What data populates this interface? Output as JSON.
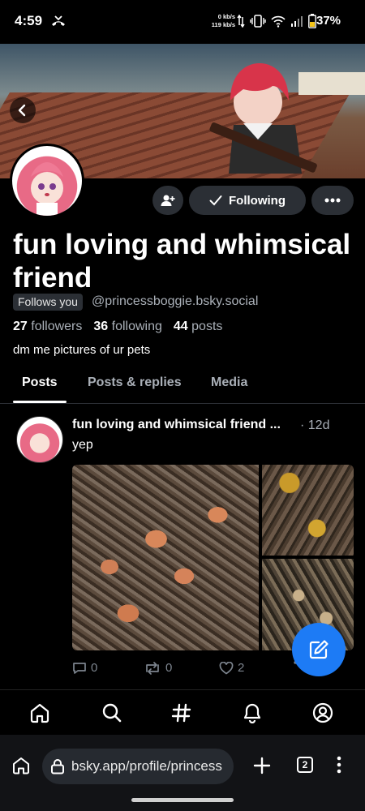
{
  "status_bar": {
    "time": "4:59",
    "net_down": "0 kb/s",
    "net_up": "119 kb/s",
    "battery": "37%"
  },
  "profile": {
    "display_name": "fun loving and whimsical friend",
    "follows_you_label": "Follows you",
    "handle": "@princessboggie.bsky.social",
    "followers_count": "27",
    "followers_label": "followers",
    "following_count": "36",
    "following_label": "following",
    "posts_count": "44",
    "posts_label": "posts",
    "bio": "dm me pictures of ur pets",
    "following_button_label": "Following"
  },
  "tabs": [
    {
      "label": "Posts",
      "active": true
    },
    {
      "label": "Posts & replies",
      "active": false
    },
    {
      "label": "Media",
      "active": false
    }
  ],
  "post": {
    "author": "fun loving and whimsical friend ...",
    "time": "· 12d",
    "text": "yep",
    "reply_count": "0",
    "repost_count": "0",
    "like_count": "2"
  },
  "bottom_nav": [
    "home-icon",
    "search-icon",
    "hashtag-icon",
    "bell-icon",
    "profile-icon"
  ],
  "browser": {
    "url": "bsky.app/profile/princess",
    "tab_count": "2"
  },
  "colors": {
    "accent": "#1d7bf5",
    "pill": "#2b2f35",
    "muted": "#aab0b8"
  }
}
